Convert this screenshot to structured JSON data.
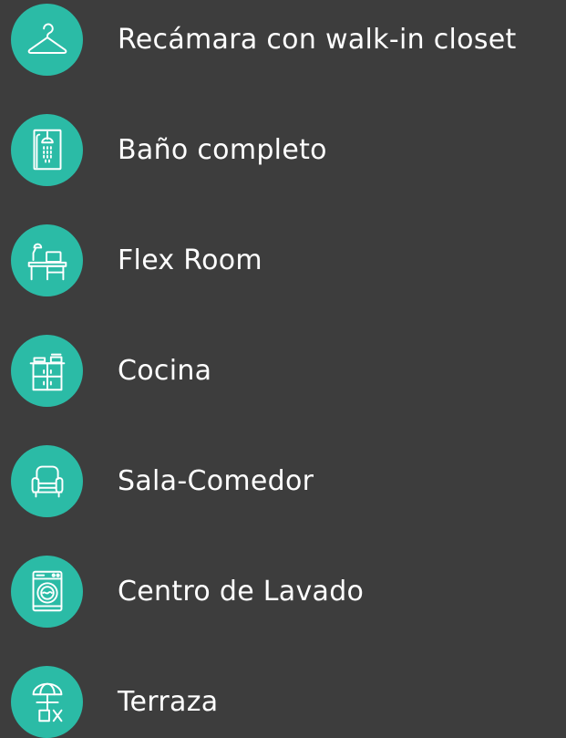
{
  "colors": {
    "background": "#3d3d3d",
    "badge": "#2bbba6",
    "text": "#ffffff"
  },
  "amenities": [
    {
      "label": "Recámara con walk-in closet",
      "icon": "hanger-icon"
    },
    {
      "label": "Baño completo",
      "icon": "shower-icon"
    },
    {
      "label": "Flex Room",
      "icon": "desk-icon"
    },
    {
      "label": "Cocina",
      "icon": "kitchen-icon"
    },
    {
      "label": "Sala-Comedor",
      "icon": "armchair-icon"
    },
    {
      "label": "Centro de Lavado",
      "icon": "washing-machine-icon"
    },
    {
      "label": "Terraza",
      "icon": "patio-umbrella-icon"
    }
  ]
}
